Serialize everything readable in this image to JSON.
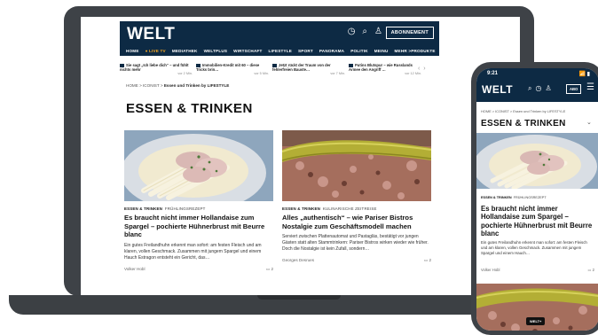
{
  "desktop": {
    "logo": "WELT",
    "subscribe_label": "ABONNEMENT",
    "nav": [
      {
        "label": "HOME",
        "live": false
      },
      {
        "label": "● LIVE TV",
        "live": true
      },
      {
        "label": "MEDIATHEK",
        "live": false
      },
      {
        "label": "WELTPLUS",
        "live": false
      },
      {
        "label": "WIRTSCHAFT",
        "live": false
      },
      {
        "label": "LIFESTYLE",
        "live": false
      },
      {
        "label": "SPORT",
        "live": false
      },
      {
        "label": "PANORAMA",
        "live": false
      },
      {
        "label": "POLITIK",
        "live": false
      },
      {
        "label": "MEINU",
        "live": false
      },
      {
        "label": "MEHR >",
        "live": false
      }
    ],
    "nav_right": "PRODUKTE",
    "ticker": [
      {
        "text": "Sie sagt „Ich liebe dich“ – und fühlt nichts mehr",
        "time": "vor 2 Min."
      },
      {
        "text": "Immobilien-Kredit mit 60 – diese Tricks brin…",
        "time": "vor 5 Min."
      },
      {
        "text": "Jetzt rückt der Traum von der fehlerfreien Bauste…",
        "time": "vor 7 Min."
      },
      {
        "text": "Putins Blutspur – wie Russlands Armee den Angriff …",
        "time": "vor 12 Min."
      }
    ],
    "breadcrumb": {
      "home": "HOME",
      "sep": ">",
      "icon": "ICONIST",
      "current": "Essen und Trinken by LIFESTYLE"
    },
    "section_title": "ESSEN & TRINKEN",
    "cards": [
      {
        "category": "ESSEN & TRINKEN",
        "topic": "FRÜHLINGSREZEPT",
        "headline": "Es braucht nicht immer Hollandaise zum Spargel – pochierte Hühnerbrust mit Beurre blanc",
        "teaser": "Ein gutes Freilandhuhn erkennt man sofort: am festen Fleisch und am klaren, vollen Geschmack. Zusammen mit jungem Spargel und einem Hauch Estragon entsteht ein Gericht, das…",
        "author": "Volker Hobl",
        "comments": "2"
      },
      {
        "category": "ESSEN & TRINKEN",
        "topic": "KULINARISCHE ZEITREISE",
        "headline": "Alles „authentisch“ – wie Pariser Bistros Nostalgie zum Geschäftsmodell machen",
        "teaser": "Serviert zwischen Plattenautomat und Pastagläs, bestätigt vor jungen Gästen statt alten Stammtrinkern: Pariser Bistros wirken wieder wie früher. Doch die Nostalgie ist kein Zufall, sondern…",
        "author": "Georges Desrues",
        "comments": "2"
      }
    ]
  },
  "mobile": {
    "time": "9:21",
    "signal": "📶 ▮",
    "logo": "WELT",
    "subscribe_label": "ABO",
    "breadcrumb": "HOME > ICONIST > Essen und Trinken by LIFESTYLE",
    "section_title": "ESSEN & TRINKEN",
    "card": {
      "category": "ESSEN & TRINKEN",
      "topic": "FRÜHLINGSREZEPT",
      "headline": "Es braucht nicht immer Hollandaise zum Spargel – pochierte Hühnerbrust mit Beurre blanc",
      "teaser": "Ein gutes Freilandhuhn erkennt man sofort: am festen Fleisch und am klaren, vollen Geschmack. Zusammen mit jungem Spargel und einem Hauch…",
      "author": "Volker Hobl",
      "comments": "2"
    },
    "second_image_badge": "WELT+"
  },
  "colors": {
    "brand_navy": "#0d2a44",
    "live_accent": "#f5a623",
    "frame_gray": "#3e4247"
  },
  "icons": [
    "clock-icon",
    "search-icon",
    "account-icon",
    "menu-icon",
    "comment-icon",
    "chevron-down-icon",
    "arrow-left-icon",
    "arrow-right-icon"
  ]
}
